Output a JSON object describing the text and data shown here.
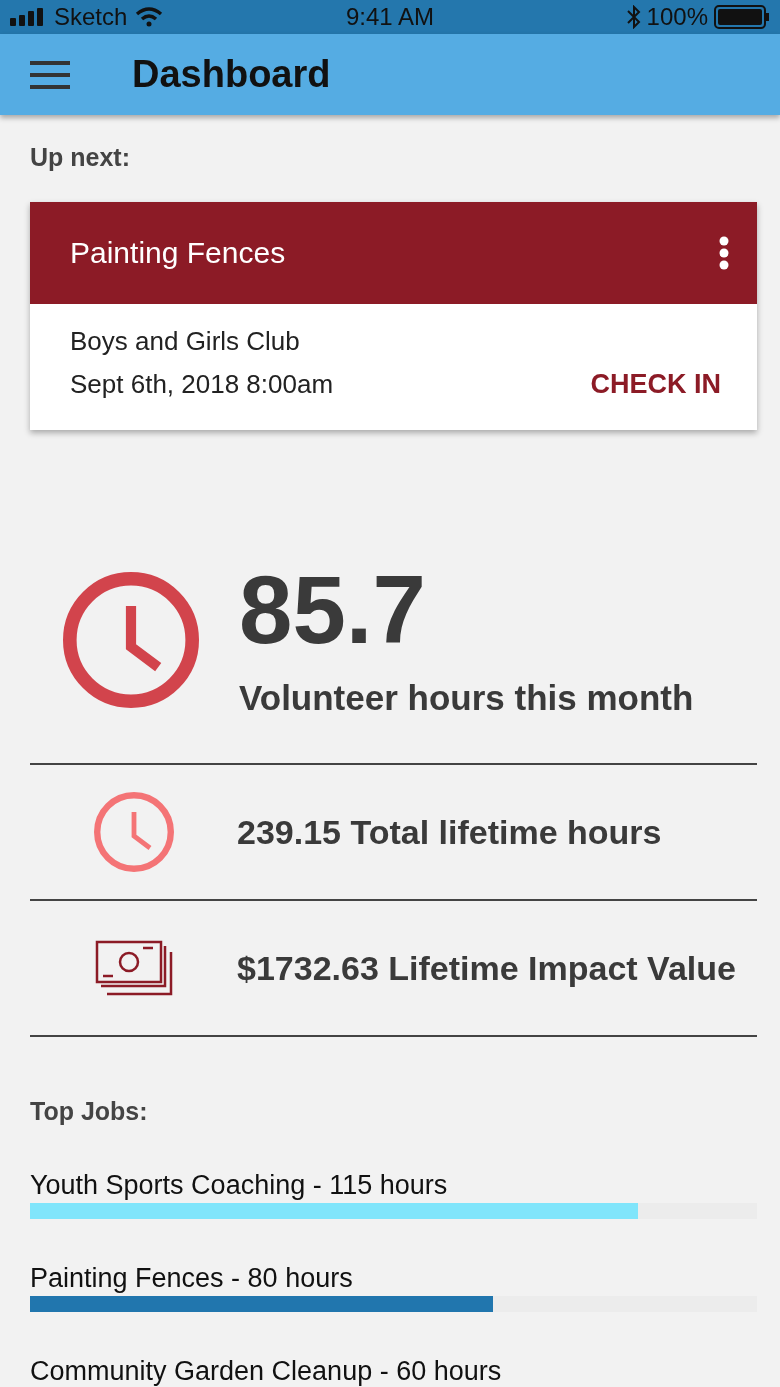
{
  "status_bar": {
    "carrier": "Sketch",
    "time": "9:41 AM",
    "battery": "100%"
  },
  "app_bar": {
    "title": "Dashboard"
  },
  "up_next": {
    "heading": "Up next:",
    "card": {
      "title": "Painting Fences",
      "organization": "Boys and Girls Club",
      "datetime": "Sept 6th, 2018 8:00am",
      "action": "CHECK IN"
    }
  },
  "month_hours": {
    "value": "85.7",
    "label": "Volunteer hours this month"
  },
  "stats": [
    {
      "kind": "clock",
      "text": "239.15 Total lifetime hours"
    },
    {
      "kind": "money",
      "text": "$1732.63 Lifetime Impact Value"
    }
  ],
  "top_jobs": {
    "heading": "Top Jobs:",
    "jobs": [
      {
        "label": "Youth Sports Coaching - 115 hours",
        "level": 0.836,
        "color": "#80e5fb"
      },
      {
        "label": "Painting Fences - 80 hours",
        "level": 0.637,
        "color": "#2176ae"
      },
      {
        "label": "Community Garden Cleanup - 60 hours"
      }
    ]
  }
}
